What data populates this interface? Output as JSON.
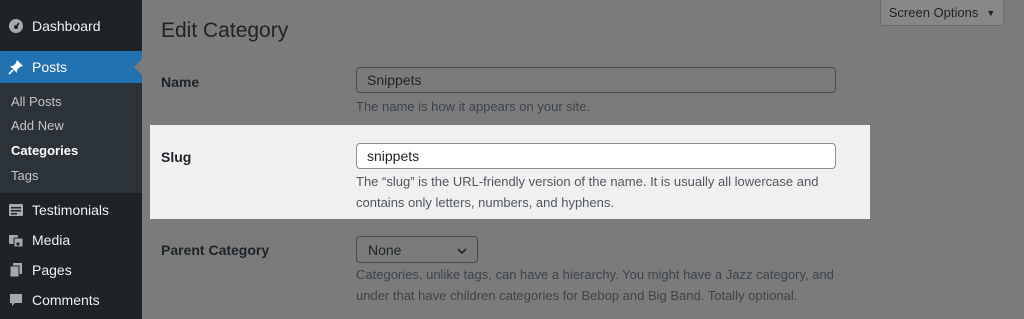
{
  "sidebar": {
    "items": [
      {
        "label": "Dashboard",
        "icon": "dashboard-icon"
      },
      {
        "label": "Posts",
        "icon": "pushpin-icon",
        "active": true
      },
      {
        "label": "Testimonials",
        "icon": "testimonials-icon"
      },
      {
        "label": "Media",
        "icon": "media-icon"
      },
      {
        "label": "Pages",
        "icon": "pages-icon"
      },
      {
        "label": "Comments",
        "icon": "comments-icon"
      }
    ],
    "submenu": [
      {
        "label": "All Posts"
      },
      {
        "label": "Add New"
      },
      {
        "label": "Categories",
        "current": true
      },
      {
        "label": "Tags"
      }
    ]
  },
  "header": {
    "title": "Edit Category",
    "screen_options_label": "Screen Options"
  },
  "form": {
    "name": {
      "label": "Name",
      "value": "Snippets",
      "description": "The name is how it appears on your site."
    },
    "slug": {
      "label": "Slug",
      "value": "snippets",
      "description": "The “slug” is the URL-friendly version of the name. It is usually all lowercase and contains only letters, numbers, and hyphens."
    },
    "parent": {
      "label": "Parent Category",
      "selected": "None",
      "description": "Categories, unlike tags, can have a hierarchy. You might have a Jazz category, and under that have children categories for Bebop and Big Band. Totally optional."
    }
  },
  "colors": {
    "sidebar_bg": "#1d2327",
    "active_menu": "#2271b1",
    "overlay": "#7b7b7b",
    "highlight_section": "#f0f0f1"
  }
}
